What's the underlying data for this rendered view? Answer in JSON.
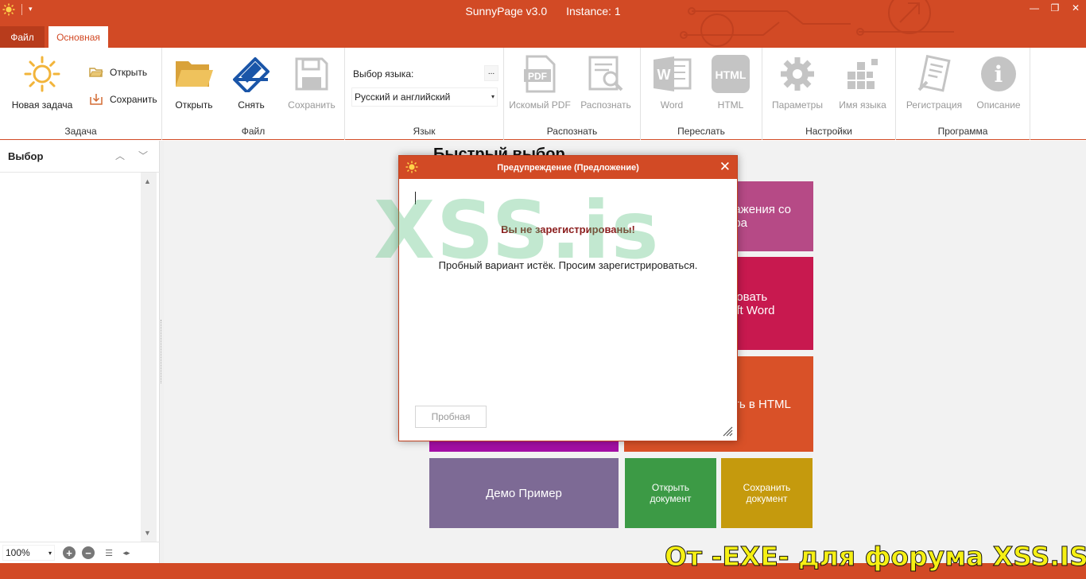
{
  "window": {
    "app_name": "SunnyPage v3.0",
    "instance": "Instance: 1",
    "minimize": "—",
    "restore": "❐",
    "close": "✕",
    "qat_arrow": "▾"
  },
  "tabs": {
    "file": "Файл",
    "main": "Основная"
  },
  "ribbon": {
    "task": {
      "label": "Задача",
      "new_task": "Новая задача",
      "open": "Открыть",
      "save": "Сохранить"
    },
    "file": {
      "label": "Файл",
      "open": "Открыть",
      "scan": "Снять",
      "save": "Сохранить"
    },
    "language": {
      "label": "Язык",
      "select_label": "Выбор языка:",
      "more": "...",
      "selected": "Русский и английский",
      "arrow": "▾"
    },
    "recognize": {
      "label": "Распознать",
      "searchable_pdf": "Искомый PDF",
      "recognize": "Распознать",
      "pdf_icon_text": "PDF"
    },
    "send": {
      "label": "Переслать",
      "word": "Word",
      "html": "HTML",
      "word_icon_text": "W",
      "html_icon_text": "HTML"
    },
    "settings": {
      "label": "Настройки",
      "parameters": "Параметры",
      "language_name": "Имя языка"
    },
    "program": {
      "label": "Программа",
      "register": "Регистрация",
      "about": "Описание",
      "info_icon_text": "i"
    }
  },
  "sidebar": {
    "title": "Выбор",
    "collapse": "︿",
    "expand": "﹀",
    "scroll_up": "▲",
    "scroll_down": "▼",
    "zoom": "100%",
    "zoom_arrow": "▾",
    "zoom_in": "+",
    "zoom_out": "−",
    "view_list": "☰",
    "view_toggle": "◂▸"
  },
  "quick_select": {
    "title": "Быстрый выбор",
    "tiles": {
      "images_scanner": [
        "ражения со",
        "ера"
      ],
      "convert_word": [
        "ровать",
        "oft Word"
      ],
      "convert_html": "ть в HTML",
      "demo": "Демо Пример",
      "open_doc": [
        "Открыть",
        "документ"
      ],
      "save_doc": [
        "Сохранить",
        "документ"
      ]
    },
    "colors": {
      "scanner": "#b64a86",
      "word": "#c8194f",
      "html": "#d95128",
      "purple": "#a40fa5",
      "demo": "#7d6a95",
      "open": "#3c9a45",
      "save": "#c59a0d"
    }
  },
  "dialog": {
    "title": "Предупреждение (Предложение)",
    "close": "✕",
    "headline": "Вы не зарегистрированы!",
    "message": "Пробный вариант истёк. Просим зарегистрироваться.",
    "trial_button": "Пробная"
  },
  "watermarks": {
    "center": "XSS.is",
    "bottom": "От -EXE- для форума XSS.IS"
  },
  "colors": {
    "accent": "#d24a25",
    "accent_dark": "#b83c1c",
    "disabled_icon": "#c4c4c4"
  }
}
